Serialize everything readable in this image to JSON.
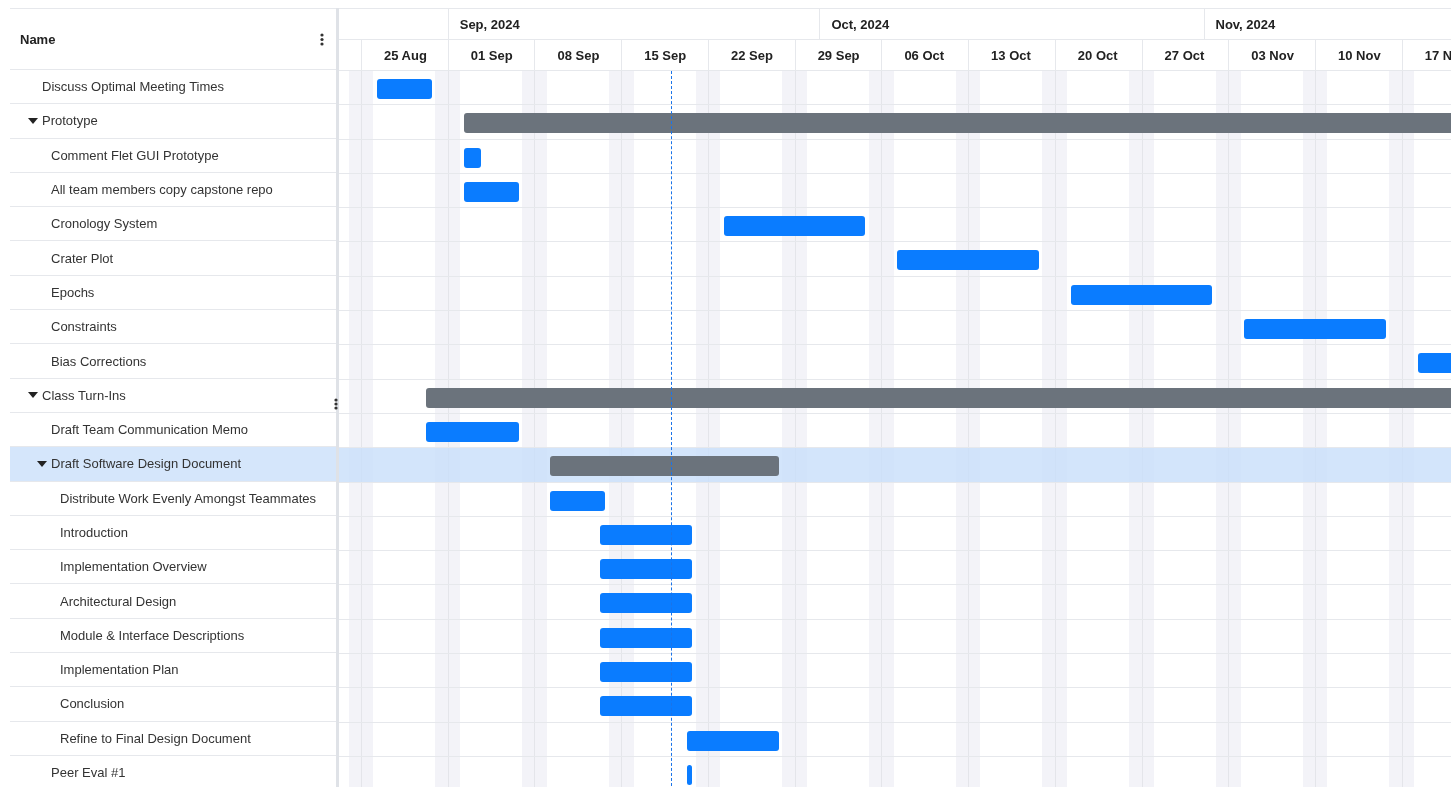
{
  "name_column": {
    "label": "Name"
  },
  "timeline": {
    "months": [
      {
        "label": "Sep, 2024"
      },
      {
        "label": "Oct, 2024"
      },
      {
        "label": "Nov, 2024"
      }
    ],
    "weeks": [
      {
        "label": "25 Aug"
      },
      {
        "label": "01 Sep"
      },
      {
        "label": "08 Sep"
      },
      {
        "label": "15 Sep"
      },
      {
        "label": "22 Sep"
      },
      {
        "label": "29 Sep"
      },
      {
        "label": "06 Oct"
      },
      {
        "label": "13 Oct"
      },
      {
        "label": "20 Oct"
      },
      {
        "label": "27 Oct"
      },
      {
        "label": "03 Nov"
      },
      {
        "label": "10 Nov"
      },
      {
        "label": "17 N"
      }
    ]
  },
  "tasks": [
    {
      "name": "Discuss Optimal Meeting Times",
      "selected": false
    },
    {
      "name": "Prototype",
      "expanded": true,
      "selected": false,
      "children": [
        {
          "name": "Comment Flet GUI Prototype",
          "selected": false
        },
        {
          "name": "All team members copy capstone repo",
          "selected": false
        },
        {
          "name": "Cronology System",
          "selected": false
        },
        {
          "name": "Crater Plot",
          "selected": false
        },
        {
          "name": "Epochs",
          "selected": false
        },
        {
          "name": "Constraints",
          "selected": false
        },
        {
          "name": "Bias Corrections",
          "selected": false
        }
      ]
    },
    {
      "name": "Class Turn-Ins",
      "expanded": true,
      "selected": false,
      "children": [
        {
          "name": "Draft Team Communication Memo",
          "selected": false
        },
        {
          "name": "Draft Software Design Document",
          "expanded": true,
          "selected": true,
          "children": [
            {
              "name": "Distribute Work Evenly Amongst Teammates",
              "selected": false
            },
            {
              "name": "Introduction",
              "selected": false
            },
            {
              "name": "Implementation Overview",
              "selected": false
            },
            {
              "name": "Architectural Design",
              "selected": false
            },
            {
              "name": "Module & Interface Descriptions",
              "selected": false
            },
            {
              "name": "Implementation Plan",
              "selected": false
            },
            {
              "name": "Conclusion",
              "selected": false
            },
            {
              "name": "Refine to Final Design Document",
              "selected": false
            }
          ]
        },
        {
          "name": "Peer Eval #1",
          "selected": false
        }
      ]
    }
  ]
}
